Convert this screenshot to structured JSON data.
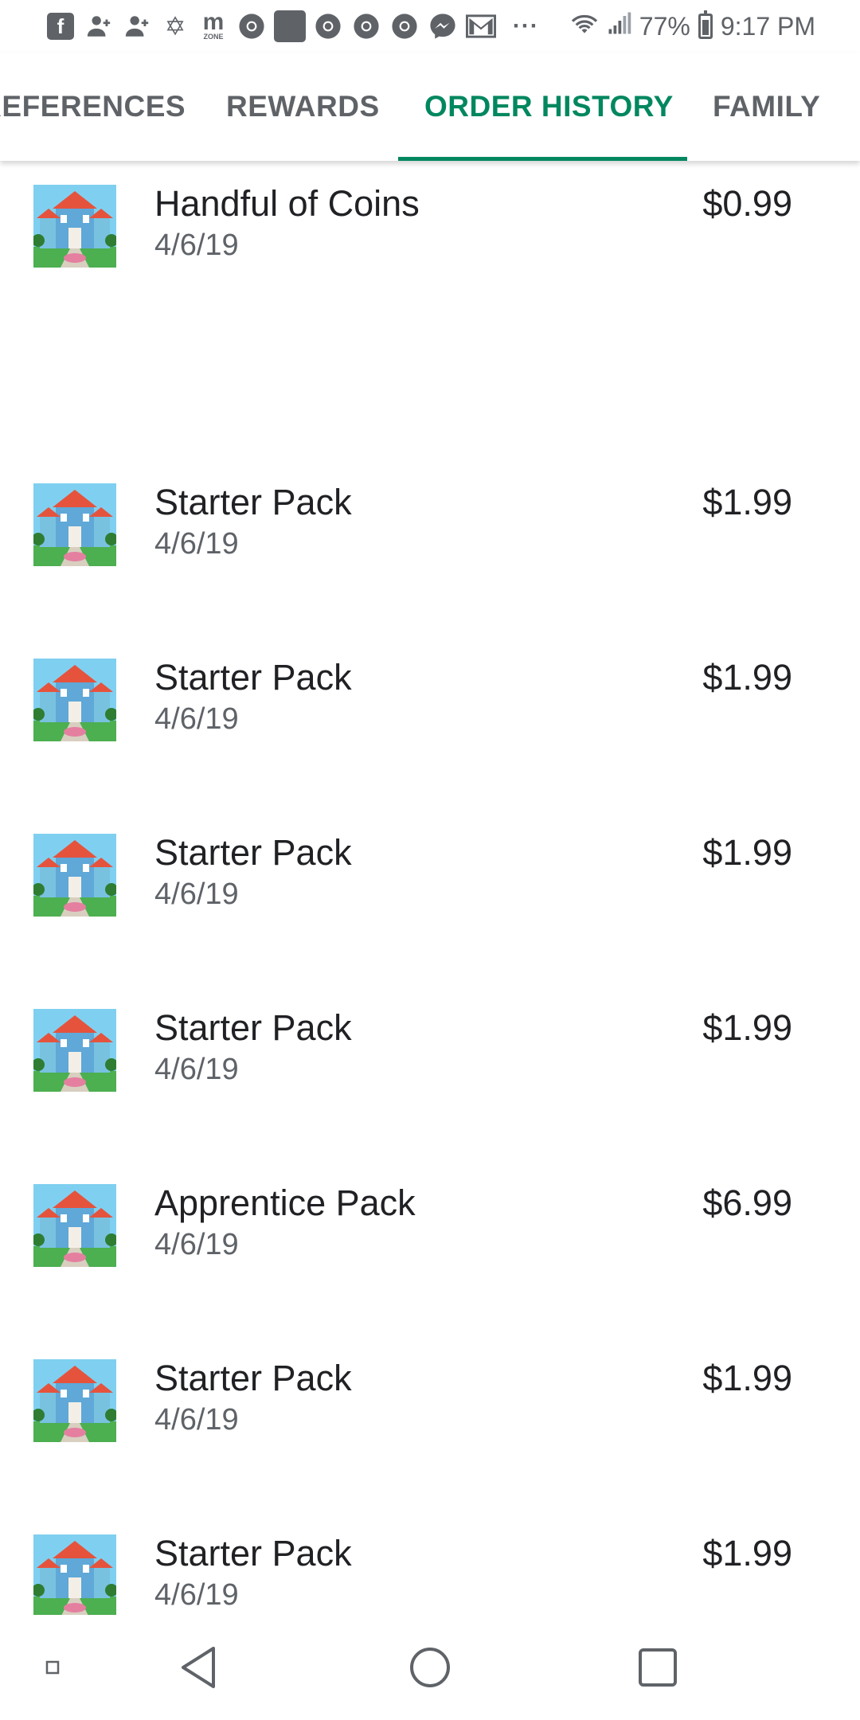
{
  "status_bar": {
    "left_icons": [
      "facebook-icon",
      "person-add-icon",
      "person-add-icon",
      "star-of-david-icon",
      "mzone-icon",
      "chrome-icon",
      "app-square-icon",
      "chrome-icon",
      "chrome-icon",
      "chrome-icon",
      "messenger-icon",
      "gmail-icon"
    ],
    "mzone_label": "m",
    "mzone_sub": "ZONE",
    "more": "···",
    "battery_percent": "77%",
    "time": "9:17 PM"
  },
  "tabs": [
    {
      "label": "PREFERENCES",
      "active": false
    },
    {
      "label": "REWARDS",
      "active": false
    },
    {
      "label": "ORDER HISTORY",
      "active": true
    },
    {
      "label": "FAMILY",
      "active": false
    }
  ],
  "orders": [
    {
      "title": "Handful of Coins",
      "date": "4/6/19",
      "price": "$0.99"
    },
    {
      "title": "Starter Pack",
      "date": "4/6/19",
      "price": "$1.99"
    },
    {
      "title": "Starter Pack",
      "date": "4/6/19",
      "price": "$1.99"
    },
    {
      "title": "Starter Pack",
      "date": "4/6/19",
      "price": "$1.99"
    },
    {
      "title": "Starter Pack",
      "date": "4/6/19",
      "price": "$1.99"
    },
    {
      "title": "Apprentice Pack",
      "date": "4/6/19",
      "price": "$6.99"
    },
    {
      "title": "Starter Pack",
      "date": "4/6/19",
      "price": "$1.99"
    },
    {
      "title": "Starter Pack",
      "date": "4/6/19",
      "price": "$1.99"
    }
  ],
  "nav_bar": {
    "buttons": [
      "overview-dot-icon",
      "back-icon",
      "home-icon",
      "recents-icon"
    ]
  },
  "colors": {
    "accent": "#01875f",
    "tab_inactive": "#5f6368",
    "text_primary": "#202124",
    "text_secondary": "#5f6368"
  }
}
